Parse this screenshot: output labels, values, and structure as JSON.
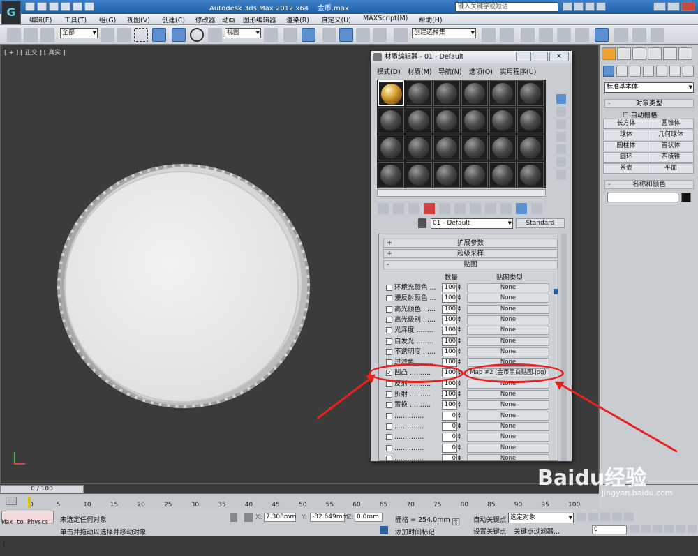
{
  "titlebar": {
    "app_title": "Autodesk 3ds Max  2012 x64",
    "file": "金币.max",
    "search_placeholder": "键入关键字或短语"
  },
  "menubar": {
    "items": [
      "编辑(E)",
      "工具(T)",
      "组(G)",
      "视图(V)",
      "创建(C)",
      "修改器",
      "动画",
      "图形编辑器",
      "渲染(R)",
      "自定义(U)",
      "MAXScript(M)",
      "帮助(H)"
    ]
  },
  "toolbar": {
    "filter_select": "全部",
    "ref_coord": "视图",
    "named_selection": "创建选择集"
  },
  "viewport": {
    "label": "[ + ] [ 正交 ] [ 真实 ]"
  },
  "right_panel": {
    "dropdown": "标准基本体",
    "object_type_header": "对象类型",
    "auto_grid": "自动栅格",
    "buttons": [
      "长方体",
      "圆锥体",
      "球体",
      "几何球体",
      "圆柱体",
      "管状体",
      "圆环",
      "四棱锥",
      "茶壶",
      "平面"
    ],
    "name_color_header": "名称和颜色"
  },
  "material_editor": {
    "title": "材质编辑器 - 01 - Default",
    "menu": [
      "模式(D)",
      "材质(M)",
      "导航(N)",
      "选项(O)",
      "实用程序(U)"
    ],
    "material_name": "01 - Default",
    "material_type": "Standard",
    "rollouts": [
      "扩展参数",
      "超级采样",
      "贴图"
    ],
    "maps_header_amount": "数量",
    "maps_header_type": "贴图类型",
    "maps": [
      {
        "name": "环境光颜色 ...",
        "checked": false,
        "amount": "100",
        "map": "None"
      },
      {
        "name": "漫反射颜色 ...",
        "checked": false,
        "amount": "100",
        "map": "None"
      },
      {
        "name": "高光颜色 ......",
        "checked": false,
        "amount": "100",
        "map": "None"
      },
      {
        "name": "高光级别 ......",
        "checked": false,
        "amount": "100",
        "map": "None"
      },
      {
        "name": "光泽度 ........",
        "checked": false,
        "amount": "100",
        "map": "None"
      },
      {
        "name": "自发光 ........",
        "checked": false,
        "amount": "100",
        "map": "None"
      },
      {
        "name": "不透明度 ......",
        "checked": false,
        "amount": "100",
        "map": "None"
      },
      {
        "name": "过滤色 ........",
        "checked": false,
        "amount": "100",
        "map": "None"
      },
      {
        "name": "凹凸 ..........",
        "checked": true,
        "amount": "100",
        "map": "Map #2 (金币黑白贴图.jpg)"
      },
      {
        "name": "反射 ..........",
        "checked": false,
        "amount": "100",
        "map": "None"
      },
      {
        "name": "折射 ..........",
        "checked": false,
        "amount": "100",
        "map": "None"
      },
      {
        "name": "置换 ..........",
        "checked": false,
        "amount": "100",
        "map": "None"
      },
      {
        "name": "..............",
        "checked": false,
        "amount": "0",
        "map": "None"
      },
      {
        "name": "..............",
        "checked": false,
        "amount": "0",
        "map": "None"
      },
      {
        "name": "..............",
        "checked": false,
        "amount": "0",
        "map": "None"
      },
      {
        "name": "..............",
        "checked": false,
        "amount": "0",
        "map": "None"
      },
      {
        "name": "..............",
        "checked": false,
        "amount": "0",
        "map": "None"
      }
    ]
  },
  "timeline": {
    "frame": "0 / 100",
    "ticks": [
      "0",
      "5",
      "10",
      "15",
      "20",
      "25",
      "30",
      "35",
      "40",
      "45",
      "50",
      "55",
      "60",
      "65",
      "70",
      "75",
      "80",
      "85",
      "90",
      "95",
      "100"
    ]
  },
  "status": {
    "script_listener": "Max to Physcs (",
    "selection": "未选定任何对象",
    "hint": "单击并拖动以选择并移动对象",
    "x_label": "X:",
    "x_value": "7.308mm",
    "y_label": "Y:",
    "y_value": "-82.649mm",
    "z_label": "Z:",
    "z_value": "0.0mm",
    "grid": "栅格 = 254.0mm",
    "add_time_tag": "添加时间标记",
    "auto_key": "自动关键点",
    "set_key": "设置关键点",
    "key_select": "选定对象",
    "key_filter": "关键点过滤器...",
    "frame_field": "0"
  },
  "watermark": {
    "brand": "Baidu经验",
    "url": "jingyan.baidu.com"
  },
  "colors": {
    "annotation": "#e8201f",
    "title_blue": "#1f5fa8"
  }
}
